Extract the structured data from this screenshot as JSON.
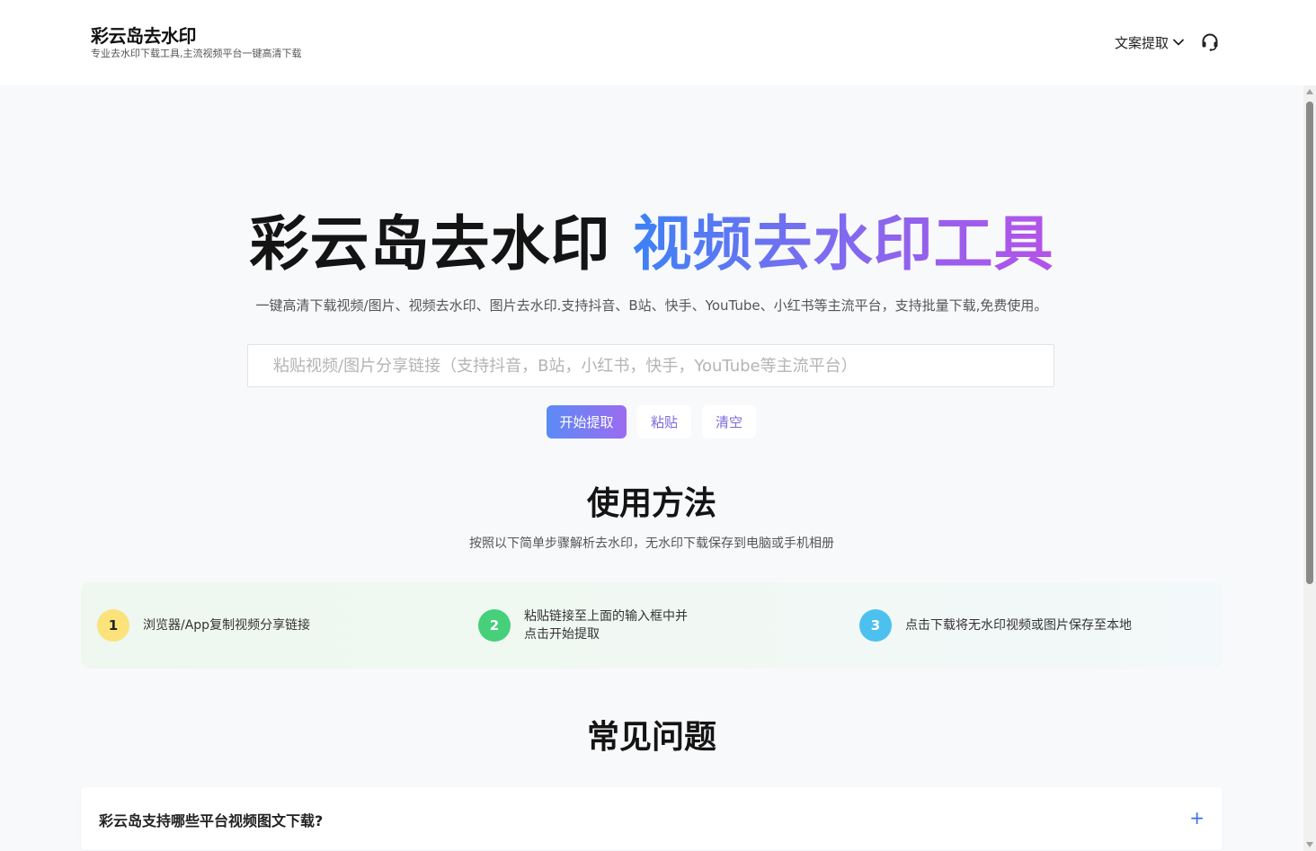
{
  "header": {
    "brand_title": "彩云岛去水印",
    "brand_subtitle": "专业去水印下载工具,主流视频平台一键高清下载",
    "nav_menu_label": "文案提取",
    "support_icon": "headset-icon"
  },
  "hero": {
    "title_dark": "彩云岛去水印",
    "title_gradient": "视频去水印工具",
    "description": "一键高清下载视频/图片、视频去水印、图片去水印.支持抖音、B站、快手、YouTube、小红书等主流平台，支持批量下载,免费使用。",
    "search_placeholder": "粘贴视频/图片分享链接（支持抖音，B站，小红书，快手，YouTube等主流平台）",
    "buttons": {
      "start": "开始提取",
      "paste": "粘贴",
      "clear": "清空"
    }
  },
  "usage": {
    "title": "使用方法",
    "subtitle": "按照以下简单步骤解析去水印，无水印下载保存到电脑或手机相册",
    "steps": [
      {
        "num": "1",
        "text": "浏览器/App复制视频分享链接",
        "color": "#fbe27a"
      },
      {
        "num": "2",
        "text_line1": "粘贴链接至上面的输入框中并",
        "text_line2": "点击开始提取",
        "color": "#46d07a"
      },
      {
        "num": "3",
        "text": "点击下载将无水印视频或图片保存至本地",
        "color": "#4cc1f0"
      }
    ]
  },
  "faq": {
    "title": "常见问题",
    "items": [
      {
        "question": "彩云岛支持哪些平台视频图文下载?",
        "toggle": "+"
      }
    ]
  },
  "colors": {
    "gradient_start": "#3b82f6",
    "gradient_end": "#b453e8",
    "accent": "#7a6ad8"
  }
}
